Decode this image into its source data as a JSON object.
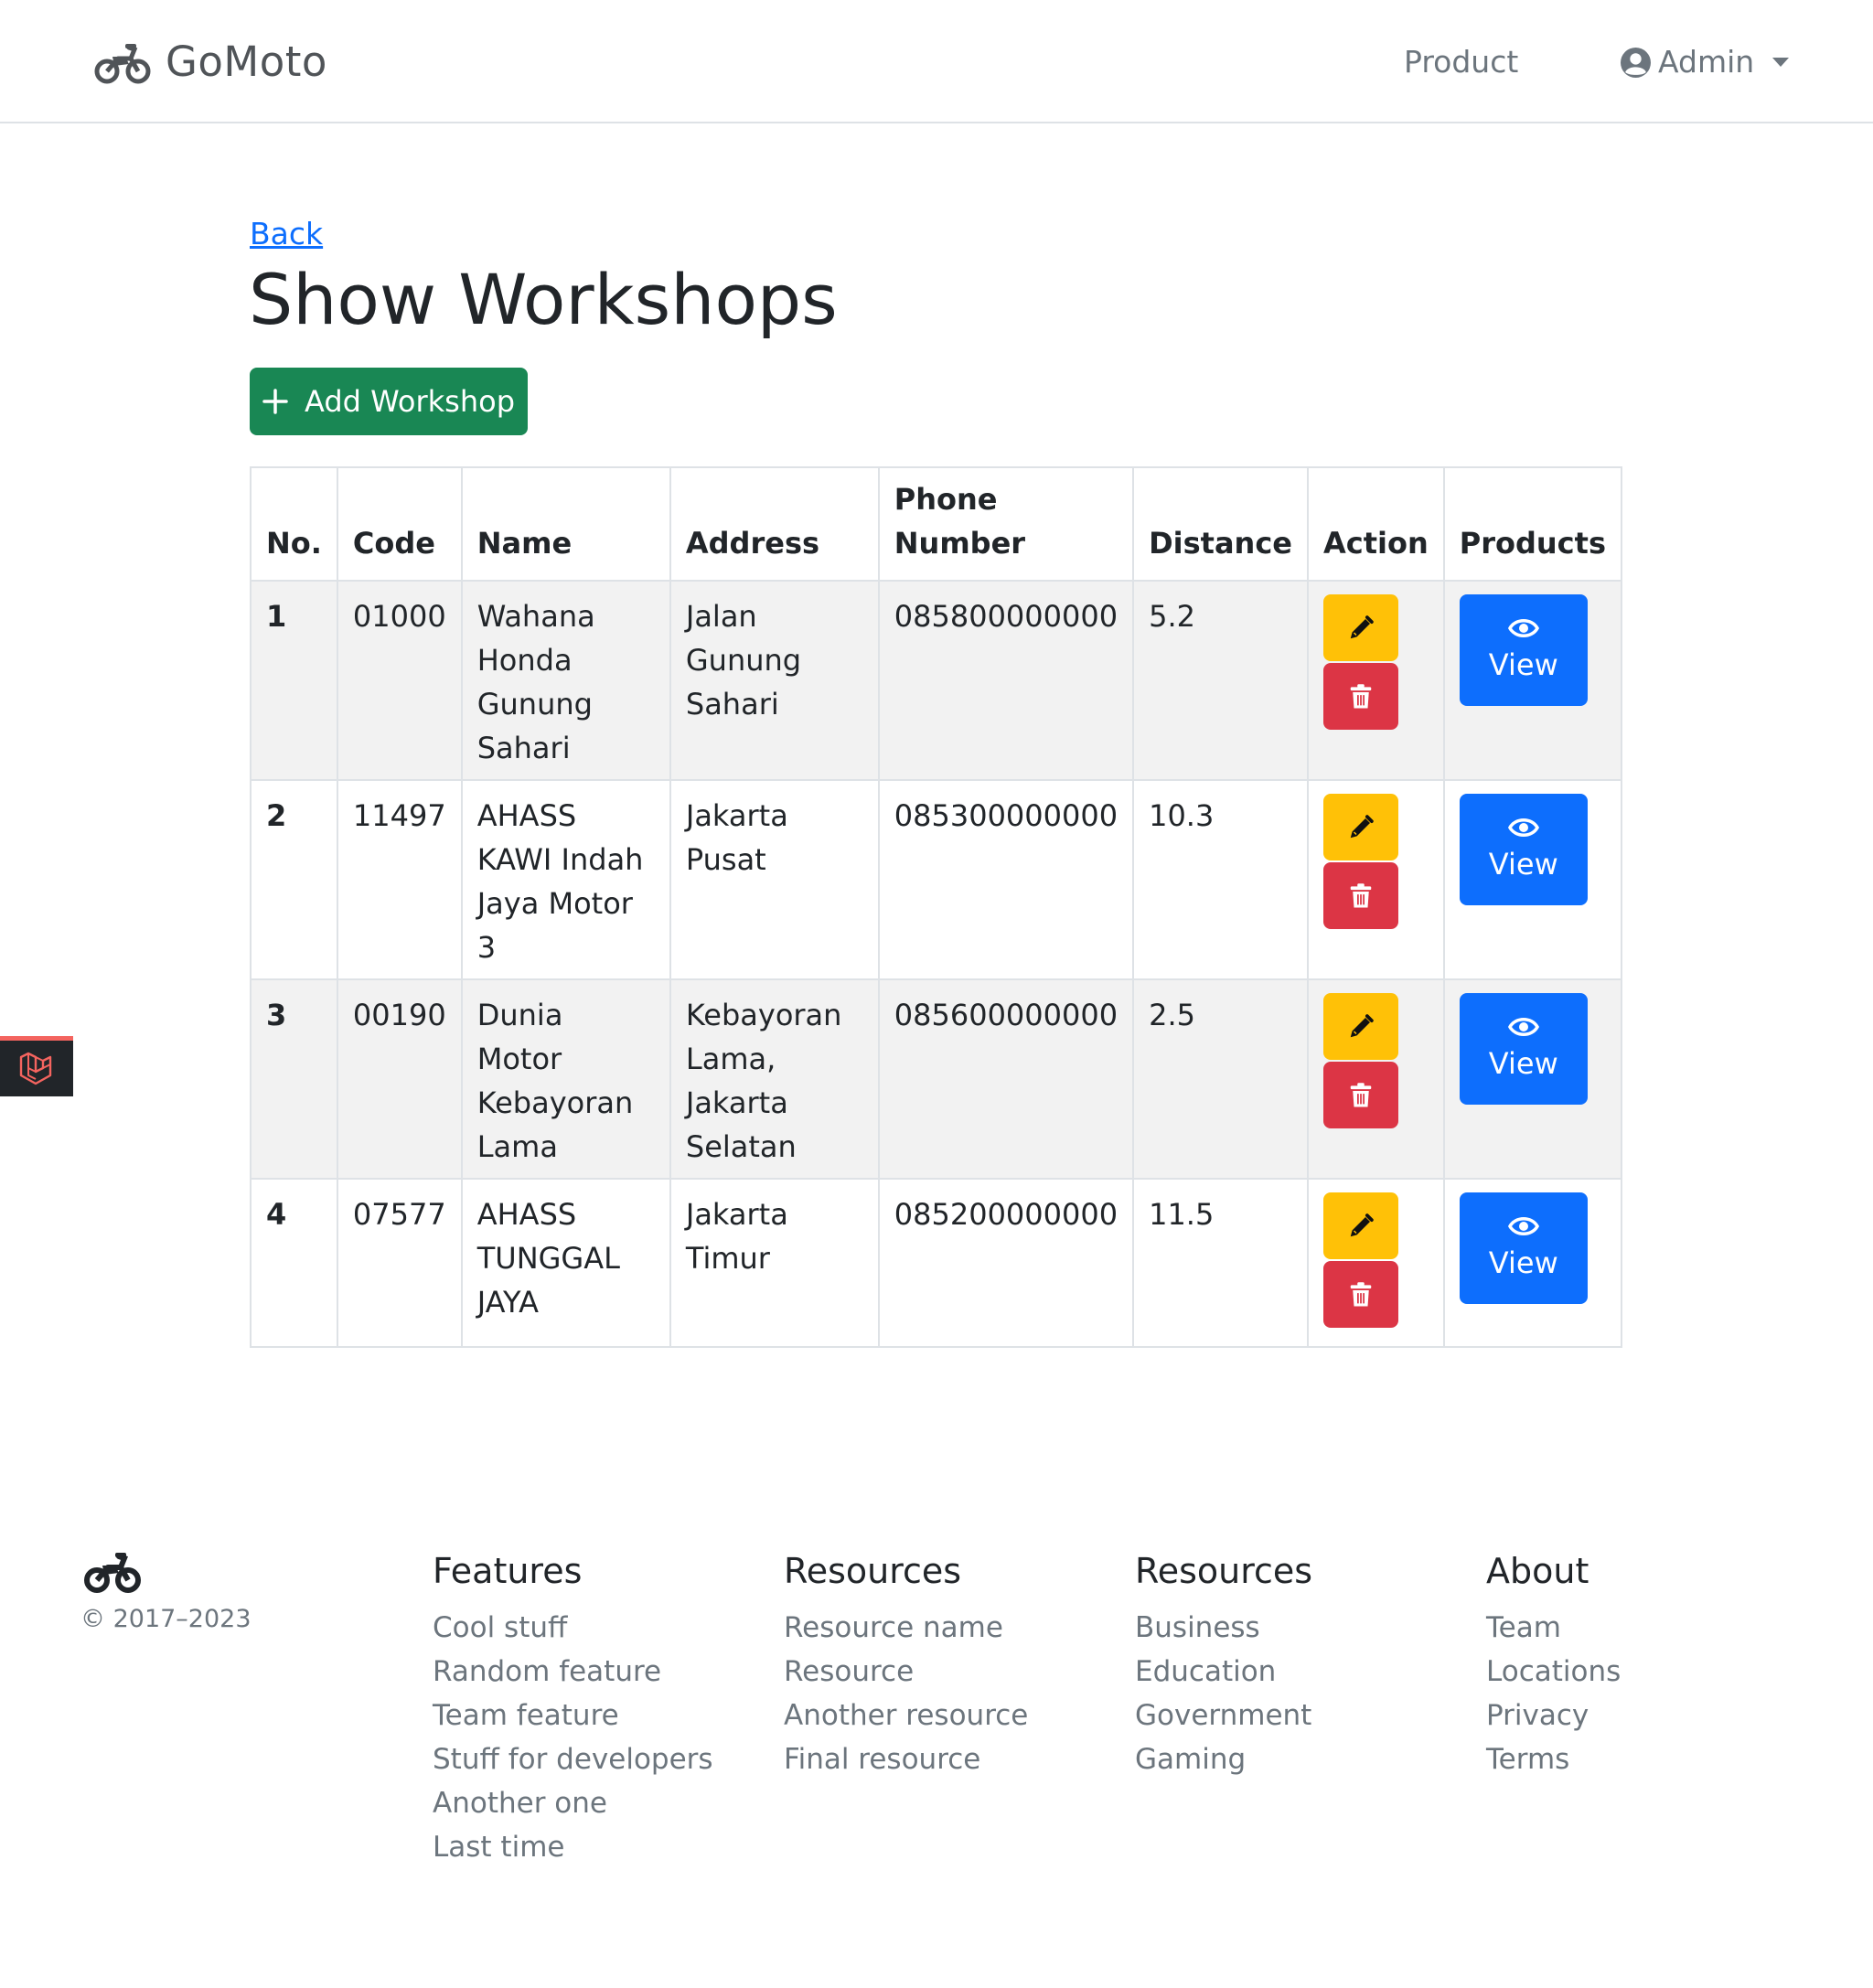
{
  "navbar": {
    "brand": "GoMoto",
    "product_link": "Product",
    "user_menu": "Admin",
    "icons": {
      "brand": "motorcycle-icon",
      "user": "user-circle-icon",
      "dropdown": "caret-down-icon"
    }
  },
  "main": {
    "back_link": "Back",
    "title": "Show Workshops",
    "add_button": "Add Workshop",
    "table": {
      "headers": {
        "no": "No.",
        "code": "Code",
        "name": "Name",
        "address": "Address",
        "phone_line1": "Phone",
        "phone_line2": "Number",
        "distance": "Distance",
        "action": "Action",
        "products": "Products"
      },
      "rows": [
        {
          "no": "1",
          "code": "01000",
          "name": "Wahana Honda Gunung Sahari",
          "address": "Jalan Gunung Sahari",
          "phone": "085800000000",
          "distance": "5.2",
          "view": "View"
        },
        {
          "no": "2",
          "code": "11497",
          "name": "AHASS KAWI Indah Jaya Motor 3",
          "address": "Jakarta Pusat",
          "phone": "085300000000",
          "distance": "10.3",
          "view": "View"
        },
        {
          "no": "3",
          "code": "00190",
          "name": "Dunia Motor Kebayoran Lama",
          "address": "Kebayoran Lama, Jakarta Selatan",
          "phone": "085600000000",
          "distance": "2.5",
          "view": "View"
        },
        {
          "no": "4",
          "code": "07577",
          "name": "AHASS TUNGGAL JAYA",
          "address": "Jakarta Timur",
          "phone": "085200000000",
          "distance": "11.5",
          "view": "View"
        }
      ]
    }
  },
  "footer": {
    "copyright": "© 2017–2023",
    "columns": [
      {
        "title": "Features",
        "links": [
          "Cool stuff",
          "Random feature",
          "Team feature",
          "Stuff for developers",
          "Another one",
          "Last time"
        ]
      },
      {
        "title": "Resources",
        "links": [
          "Resource name",
          "Resource",
          "Another resource",
          "Final resource"
        ]
      },
      {
        "title": "Resources",
        "links": [
          "Business",
          "Education",
          "Government",
          "Gaming"
        ]
      },
      {
        "title": "About",
        "links": [
          "Team",
          "Locations",
          "Privacy",
          "Terms"
        ]
      }
    ]
  },
  "colors": {
    "primary": "#0d6efd",
    "success": "#198754",
    "warning": "#ffc107",
    "danger": "#dc3545",
    "muted": "#6c757d",
    "debugbar_accent": "#f4645f"
  }
}
